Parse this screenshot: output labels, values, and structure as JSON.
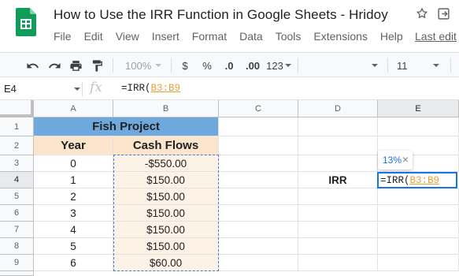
{
  "app": {
    "doc_title": "How to Use the IRR Function in Google Sheets - Hridoy",
    "last_edit": "Last edit"
  },
  "menu": [
    "File",
    "Edit",
    "View",
    "Insert",
    "Format",
    "Data",
    "Tools",
    "Extensions",
    "Help"
  ],
  "toolbar": {
    "zoom": "100%",
    "currency": "$",
    "percent": "%",
    "decrease_decimal": ".0",
    "increase_decimal": ".00",
    "more_formats": "123",
    "font_size": "11"
  },
  "formula_bar": {
    "name_box": "E4",
    "fx": "fx",
    "formula_prefix": "=IRR(",
    "formula_ref": "B3:B9"
  },
  "columns": [
    "A",
    "B",
    "C",
    "D",
    "E"
  ],
  "rows": [
    "1",
    "2",
    "3",
    "4",
    "5",
    "6",
    "7",
    "8",
    "9"
  ],
  "sheet": {
    "title": "Fish Project",
    "header_year": "Year",
    "header_cash": "Cash Flows",
    "years": [
      "0",
      "1",
      "2",
      "3",
      "4",
      "5",
      "6"
    ],
    "cash_flows": [
      "-$550.00",
      "$150.00",
      "$150.00",
      "$150.00",
      "$150.00",
      "$150.00",
      "$60.00"
    ],
    "irr_label": "IRR",
    "active_cell_prefix": "=IRR(",
    "active_cell_ref": "B3:B9"
  },
  "tooltip": {
    "value": "13%",
    "close": "×"
  },
  "colors": {
    "title_fill": "#6fa8dc",
    "header_fill": "#fce5cd",
    "cashflow_fill": "#fdf2e6",
    "range_ref": "#e8a03c",
    "selection": "#1a73e8"
  },
  "icons": [
    "sheets-logo-icon",
    "star-icon",
    "move-to-folder-icon",
    "undo-icon",
    "redo-icon",
    "print-icon",
    "paint-format-icon",
    "fx-icon",
    "close-icon"
  ]
}
